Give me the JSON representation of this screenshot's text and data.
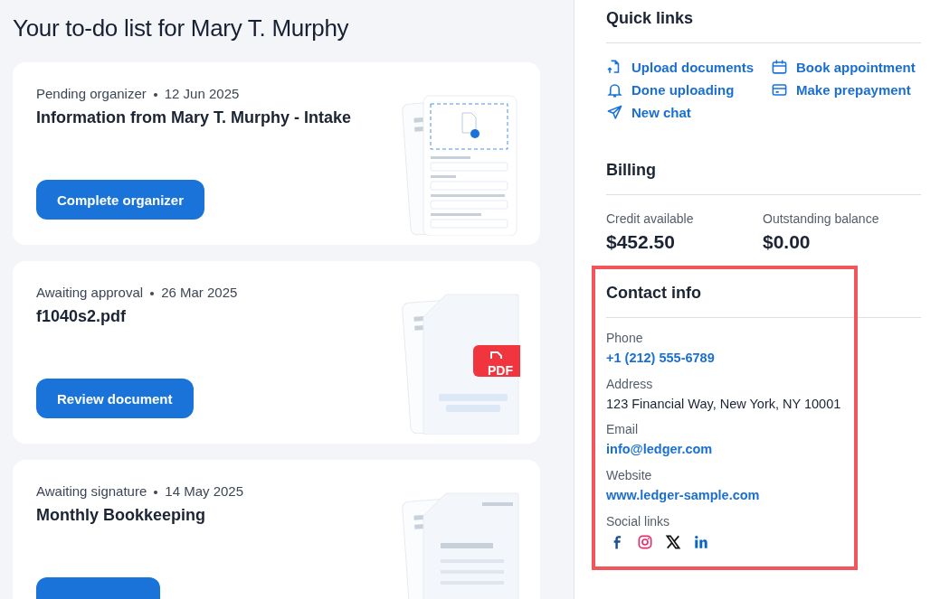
{
  "page_title": "Your to-do list for Mary T. Murphy",
  "tasks": [
    {
      "status": "Pending organizer",
      "date": "12 Jun 2025",
      "title": "Information from Mary T. Murphy - Intake",
      "button": "Complete organizer",
      "illustration": {
        "kind": "organizer"
      }
    },
    {
      "status": "Awaiting approval",
      "date": "26 Mar 2025",
      "title": "f1040s2.pdf",
      "button": "Review document",
      "illustration": {
        "kind": "pdf",
        "badge": "PDF"
      }
    },
    {
      "status": "Awaiting signature",
      "date": "14 May 2025",
      "title": "Monthly Bookkeeping",
      "illustration": {
        "kind": "document"
      }
    }
  ],
  "quick_links": {
    "title": "Quick links",
    "items": [
      {
        "label": "Upload documents"
      },
      {
        "label": "Book appointment"
      },
      {
        "label": "Done uploading"
      },
      {
        "label": "Make prepayment"
      },
      {
        "label": "New chat"
      }
    ]
  },
  "billing": {
    "title": "Billing",
    "items": [
      {
        "label": "Credit available",
        "value": "$452.50"
      },
      {
        "label": "Outstanding balance",
        "value": "$0.00"
      }
    ]
  },
  "contact": {
    "title": "Contact info",
    "highlighted": true,
    "fields": [
      {
        "label": "Phone",
        "value": "+1 (212) 555-6789",
        "kind": "link"
      },
      {
        "label": "Address",
        "value": "123 Financial Way, New York, NY 10001",
        "kind": "text"
      },
      {
        "label": "Email",
        "value": "info@ledger.com",
        "kind": "link"
      },
      {
        "label": "Website",
        "value": "www.ledger-sample.com",
        "kind": "link"
      }
    ],
    "social_label": "Social links"
  }
}
